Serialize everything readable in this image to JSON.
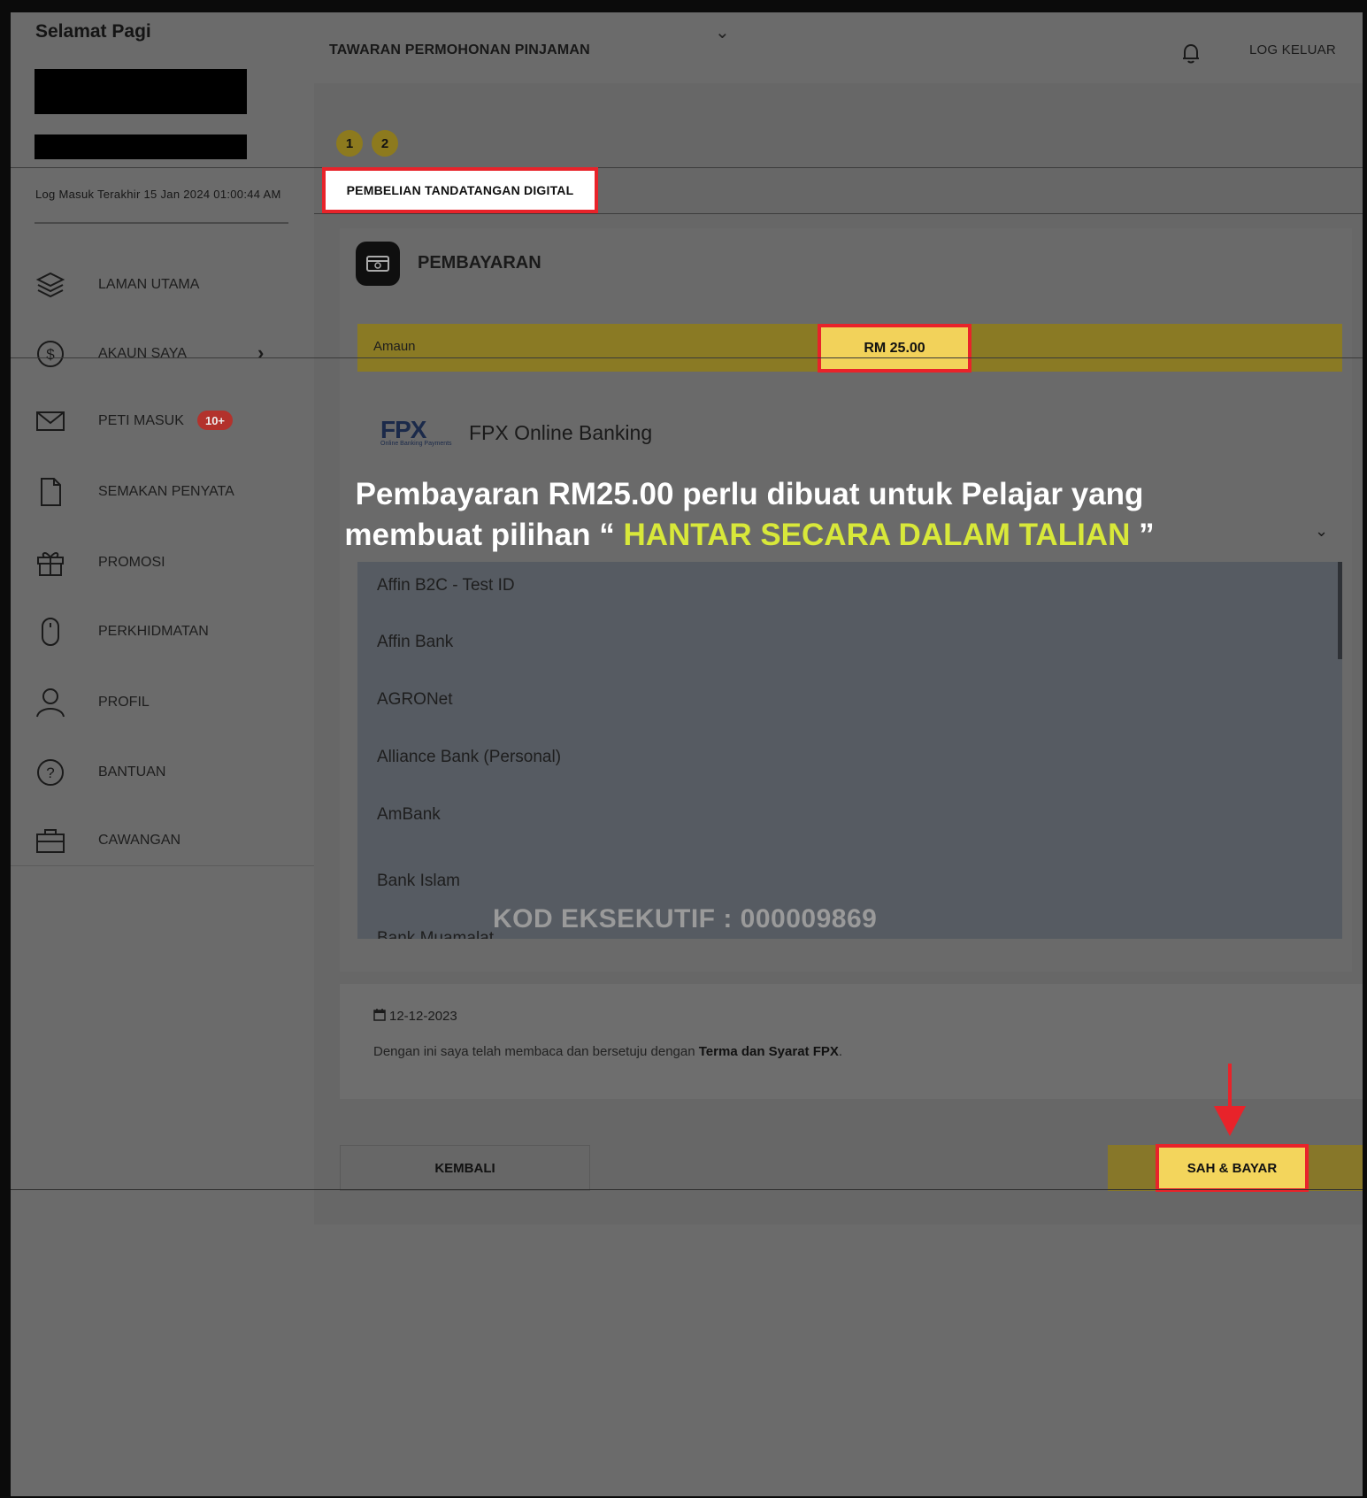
{
  "sidebar": {
    "greeting": "Selamat Pagi",
    "last_login": "Log Masuk Terakhir 15 Jan 2024 01:00:44 AM",
    "items": [
      {
        "label": "LAMAN UTAMA",
        "icon": "layers-icon"
      },
      {
        "label": "AKAUN SAYA",
        "icon": "dollar-circle-icon"
      },
      {
        "label": "PETI MASUK",
        "icon": "mail-icon",
        "badge": "10+"
      },
      {
        "label": "SEMAKAN PENYATA",
        "icon": "document-icon"
      },
      {
        "label": "PROMOSI",
        "icon": "gift-icon"
      },
      {
        "label": "PERKHIDMATAN",
        "icon": "mouse-icon"
      },
      {
        "label": "PROFIL",
        "icon": "user-icon"
      },
      {
        "label": "BANTUAN",
        "icon": "help-icon"
      },
      {
        "label": "CAWANGAN",
        "icon": "briefcase-icon"
      }
    ]
  },
  "header": {
    "title": "TAWARAN PERMOHONAN PINJAMAN",
    "logout_label": "LOG KELUAR"
  },
  "steps": [
    "1",
    "2"
  ],
  "tab": {
    "label": "PEMBELIAN TANDATANGAN DIGITAL"
  },
  "payment": {
    "title": "PEMBAYARAN",
    "amount_label": "Amaun",
    "amount_value": "RM 25.00",
    "fpx_logo_text": "FPX",
    "fpx_logo_sub": "Online Banking Payments",
    "fpx_title": "FPX Online Banking",
    "banks": [
      "Affin B2C - Test ID",
      "Affin Bank",
      "AGRONet",
      "Alliance Bank (Personal)",
      "AmBank",
      "Bank Islam",
      "Bank Muamalat"
    ]
  },
  "overlay": {
    "line1": "Pembayaran RM25.00 perlu dibuat untuk Pelajar yang",
    "line2_prefix": "membuat pilihan “ ",
    "line2_highlight": "HANTAR SECARA DALAM TALIAN",
    "line2_suffix": " ”",
    "kod": "KOD EKSEKUTIF : 000009869"
  },
  "footer": {
    "date": "12-12-2023",
    "terms_prefix": "Dengan ini saya telah membaca dan bersetuju dengan ",
    "terms_link": "Terma dan Syarat FPX",
    "terms_suffix": ".",
    "back_label": "KEMBALI",
    "pay_label": "SAH & BAYAR"
  },
  "colors": {
    "accent_yellow": "#f2d25a",
    "highlight_red": "#e8232a",
    "overlay_highlight": "#d8e83a",
    "badge_red": "#b3322c"
  }
}
